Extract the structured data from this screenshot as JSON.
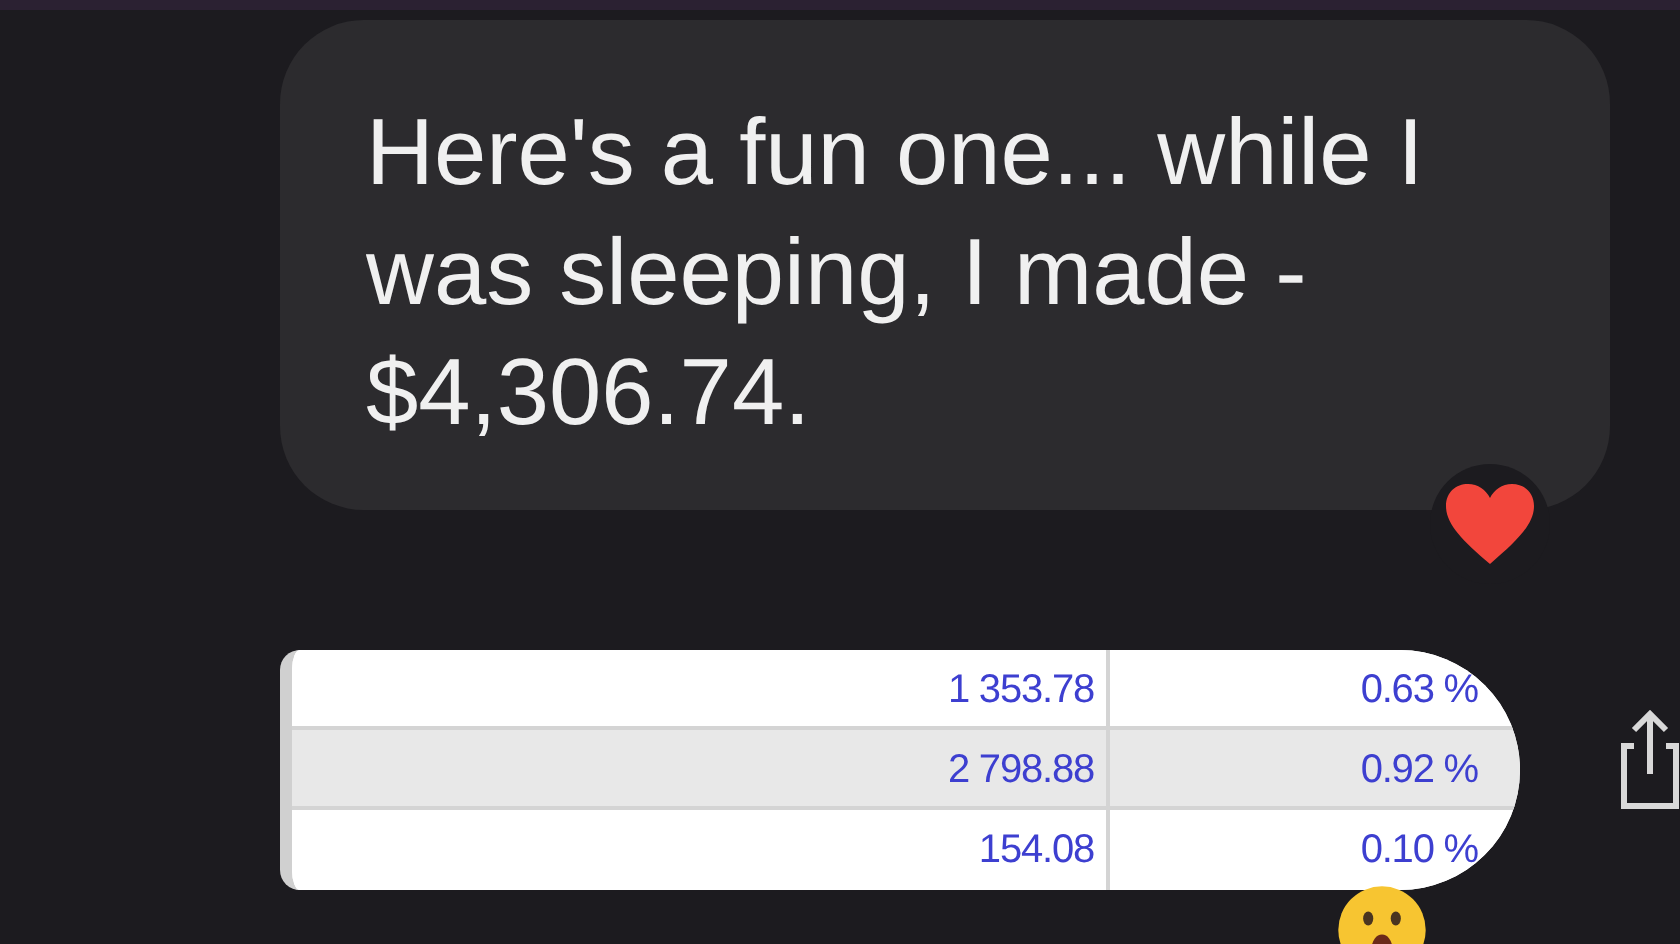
{
  "message": {
    "text": "Here's a fun one... while I was sleeping, I made - $4,306.74."
  },
  "table": {
    "rows": [
      {
        "amount": "1 353.78",
        "percent": "0.63 %",
        "selected": false
      },
      {
        "amount": "2 798.88",
        "percent": "0.92 %",
        "selected": true
      },
      {
        "amount": "154.08",
        "percent": "0.10 %",
        "selected": false
      }
    ]
  }
}
